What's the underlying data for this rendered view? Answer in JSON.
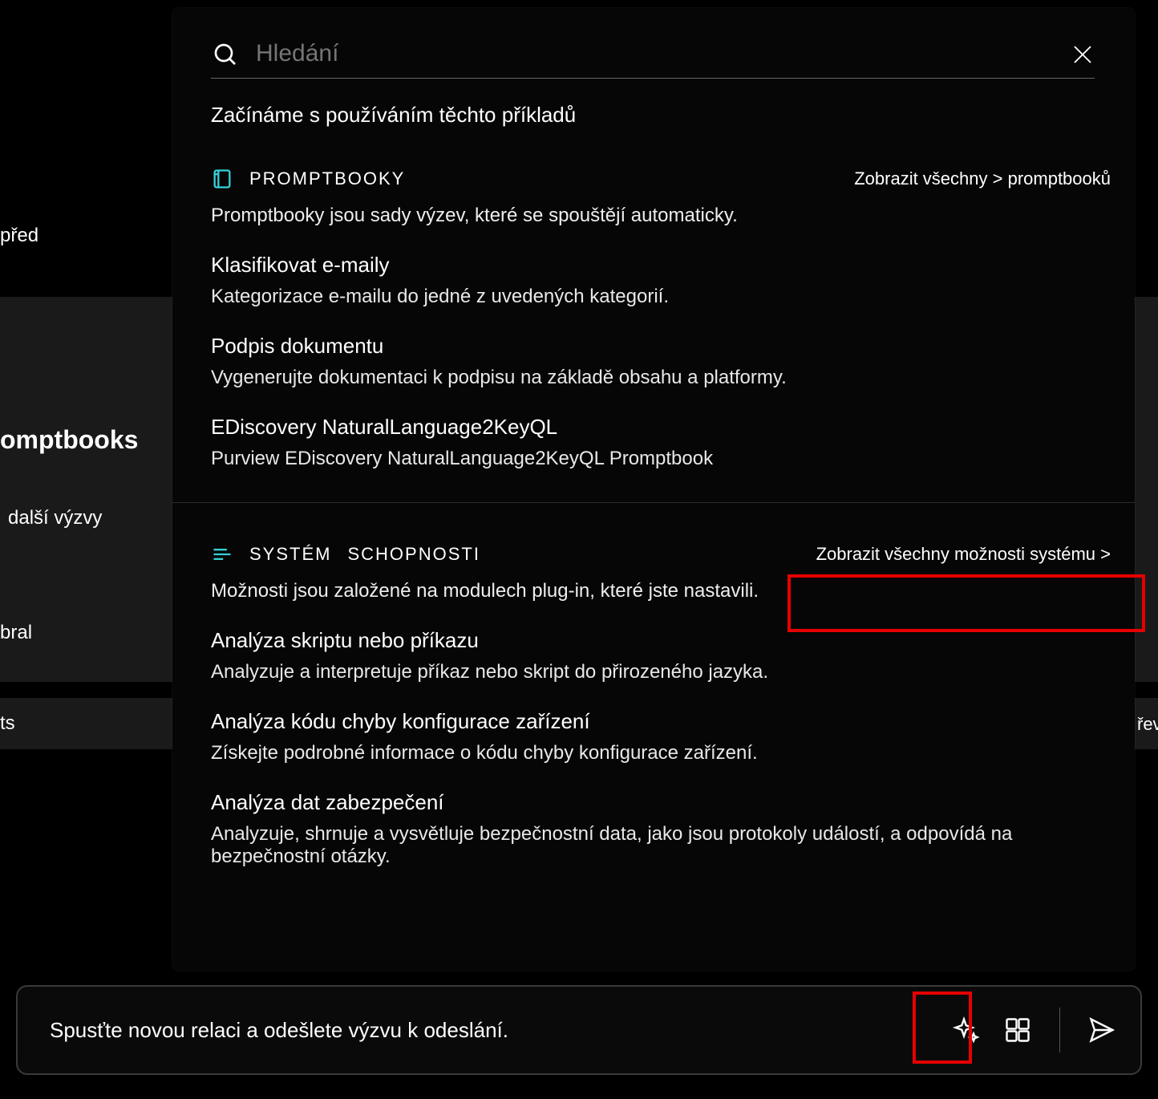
{
  "search": {
    "placeholder": "Hledání"
  },
  "intro": "Začínáme s používáním těchto příkladů",
  "background": {
    "time_label": "před",
    "frag_promptbooks": "omptbooks",
    "frag_more_prompts": "další výzvy",
    "frag_bral": "bral",
    "frag_ts": "ts",
    "frag_rev": "řev"
  },
  "promptbooks": {
    "header_label": "PROMPTBOOKY",
    "view_all_label": "Zobrazit všechny > promptbooků",
    "description": "Promptbooky jsou sady výzev, které se spouštějí automaticky.",
    "items": [
      {
        "title": "Klasifikovat e-maily",
        "desc": "Kategorizace e-mailu do jedné z uvedených kategorií."
      },
      {
        "title": "Podpis dokumentu",
        "desc": "Vygenerujte dokumentaci k podpisu na základě obsahu a platformy."
      },
      {
        "title": "EDiscovery NaturalLanguage2KeyQL",
        "desc": "Purview EDiscovery NaturalLanguage2KeyQL Promptbook"
      }
    ]
  },
  "system": {
    "header_label_a": "SYSTÉM",
    "header_label_b": "SCHOPNOSTI",
    "view_all_label": "Zobrazit všechny možnosti systému >",
    "description": "Možnosti jsou založené na modulech plug-in, které jste nastavili.",
    "items": [
      {
        "title": "Analýza skriptu nebo příkazu",
        "desc": "Analyzuje a interpretuje příkaz nebo skript do přirozeného jazyka."
      },
      {
        "title": "Analýza kódu chyby konfigurace zařízení",
        "desc": "Získejte podrobné informace o kódu chyby konfigurace zařízení."
      },
      {
        "title": "Analýza dat zabezpečení",
        "desc": "Analyzuje, shrnuje a vysvětluje bezpečnostní data, jako jsou protokoly událostí, a odpovídá na bezpečnostní otázky."
      }
    ]
  },
  "prompt_bar": {
    "text": "Spusťte novou relaci a odešlete výzvu k odeslání."
  },
  "colors": {
    "accent_cyan": "#35d0d6",
    "highlight_red": "#e60000"
  }
}
